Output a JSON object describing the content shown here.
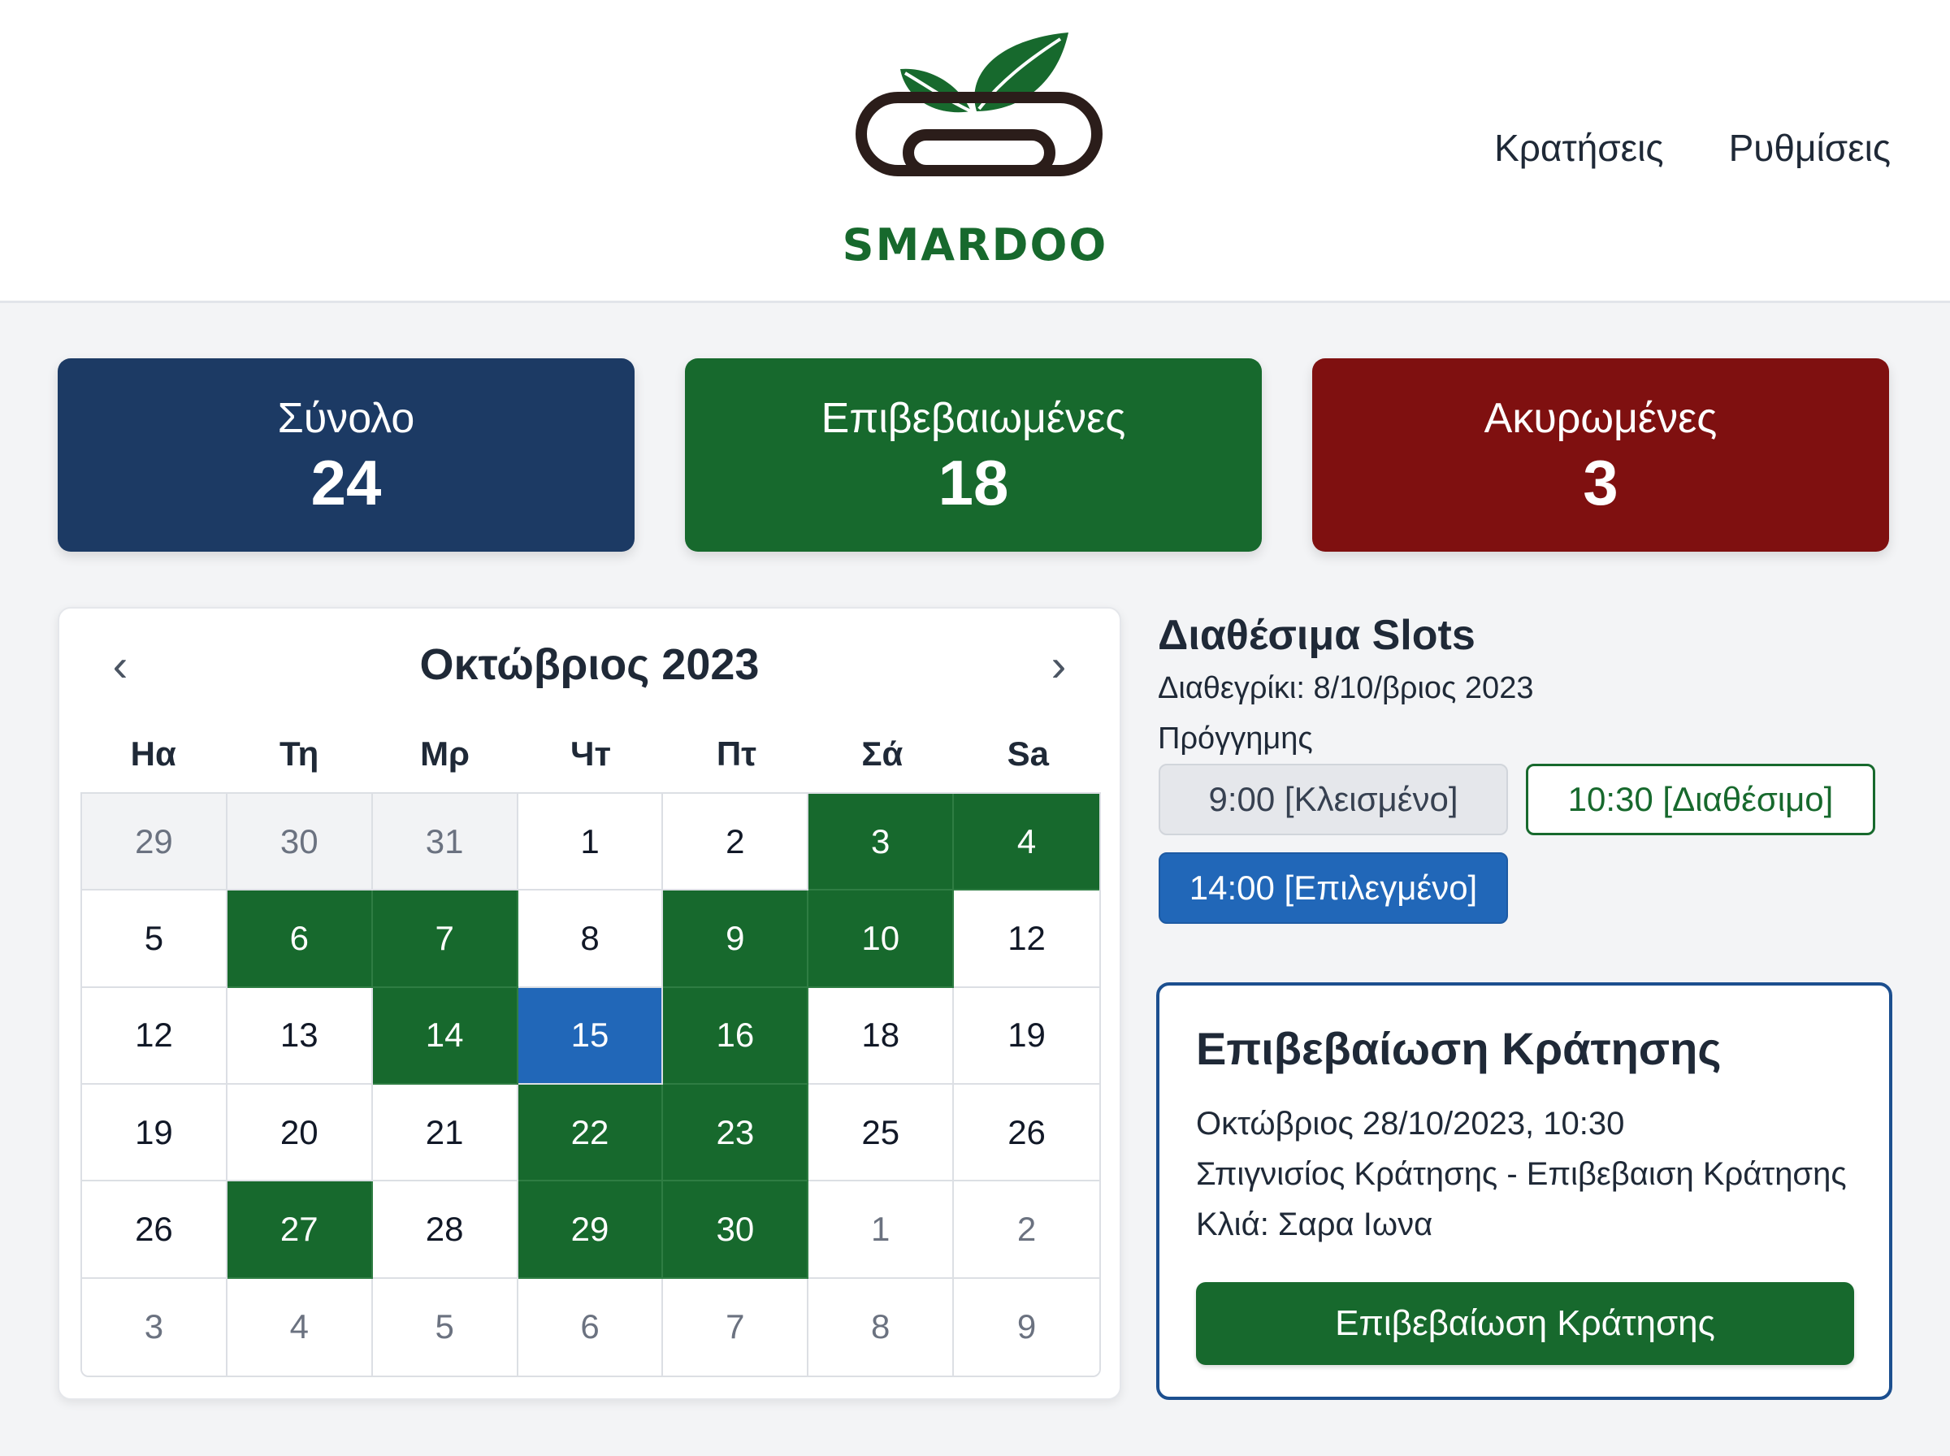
{
  "brand": {
    "name": "SMARDOO",
    "green": "#17692d",
    "dark": "#2b1d1a"
  },
  "nav": {
    "items": [
      {
        "label": "Κρατήσεις"
      },
      {
        "label": "Ρυθμίσεις"
      }
    ]
  },
  "stats": {
    "total": {
      "label": "Σύνολο",
      "value": "24",
      "color": "#1c3a64"
    },
    "confirmed": {
      "label": "Επιβεβαιωμένες",
      "value": "18",
      "color": "#17692d"
    },
    "cancelled": {
      "label": "Ακυρωμένες",
      "value": "3",
      "color": "#7f1010"
    }
  },
  "calendar": {
    "title": "Οκτώβριος 2023",
    "prev_icon": "chevron-left-icon",
    "next_icon": "chevron-right-icon",
    "weekdays": [
      "Ηα",
      "Τη",
      "Μρ",
      "Чт",
      "Πτ",
      "Σά",
      "Sa"
    ],
    "days": [
      {
        "d": "29",
        "s": "prev"
      },
      {
        "d": "30",
        "s": "prev"
      },
      {
        "d": "31",
        "s": "prev"
      },
      {
        "d": "1",
        "s": ""
      },
      {
        "d": "2",
        "s": ""
      },
      {
        "d": "3",
        "s": "booked"
      },
      {
        "d": "4",
        "s": "booked"
      },
      {
        "d": "5",
        "s": ""
      },
      {
        "d": "6",
        "s": "booked"
      },
      {
        "d": "7",
        "s": "booked"
      },
      {
        "d": "8",
        "s": ""
      },
      {
        "d": "9",
        "s": "booked"
      },
      {
        "d": "10",
        "s": "booked"
      },
      {
        "d": "12",
        "s": ""
      },
      {
        "d": "12",
        "s": ""
      },
      {
        "d": "13",
        "s": ""
      },
      {
        "d": "14",
        "s": "booked"
      },
      {
        "d": "15",
        "s": "selected"
      },
      {
        "d": "16",
        "s": "booked"
      },
      {
        "d": "18",
        "s": ""
      },
      {
        "d": "19",
        "s": ""
      },
      {
        "d": "19",
        "s": ""
      },
      {
        "d": "20",
        "s": ""
      },
      {
        "d": "21",
        "s": ""
      },
      {
        "d": "22",
        "s": "booked"
      },
      {
        "d": "23",
        "s": "booked"
      },
      {
        "d": "25",
        "s": ""
      },
      {
        "d": "26",
        "s": ""
      },
      {
        "d": "26",
        "s": ""
      },
      {
        "d": "27",
        "s": "booked"
      },
      {
        "d": "28",
        "s": ""
      },
      {
        "d": "29",
        "s": "booked"
      },
      {
        "d": "30",
        "s": "booked"
      },
      {
        "d": "1",
        "s": "other"
      },
      {
        "d": "2",
        "s": "other"
      },
      {
        "d": "3",
        "s": "other"
      },
      {
        "d": "4",
        "s": "other"
      },
      {
        "d": "5",
        "s": "other"
      },
      {
        "d": "6",
        "s": "other"
      },
      {
        "d": "7",
        "s": "other"
      },
      {
        "d": "8",
        "s": "other"
      },
      {
        "d": "9",
        "s": "other"
      }
    ],
    "colors": {
      "booked": "#17692d",
      "selected": "#2167b8"
    }
  },
  "slots": {
    "title": "Διαθέσιμα Slots",
    "subtitle": "Διαθεγρίκι: 8/10/βριος 2023",
    "label": "Πρόγγημης",
    "items": [
      {
        "label": "9:00 [Κλεισμένο]",
        "state": "closed"
      },
      {
        "label": "10:30 [Διαθέσιμο]",
        "state": "available"
      },
      {
        "label": "14:00 [Επιλεγμένο]",
        "state": "selected"
      }
    ]
  },
  "confirmation": {
    "title": "Επιβεβαίωση Κράτησης",
    "date_line": "Οκτώβριος 28/10/2023, 10:30",
    "desc_line": "Σπιγνισίος Κράτησης - Επιβεβαιση Κράτησης",
    "client_line": "Κλιά: Σαρα Ιωνα",
    "button_label": "Επιβεβαίωση Κράτησης"
  }
}
